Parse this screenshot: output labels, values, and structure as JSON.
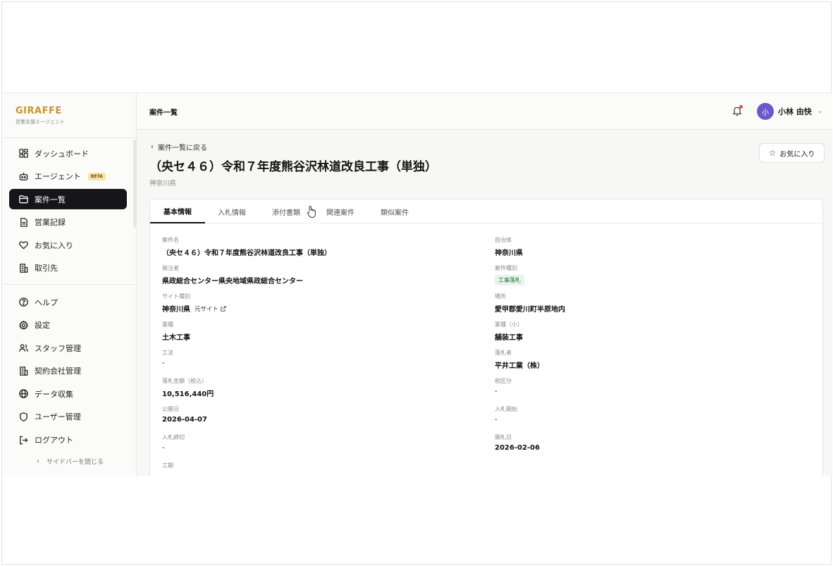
{
  "brand": {
    "name": "GIRAFFE",
    "subtitle": "営業支援エージェント"
  },
  "sidebar": {
    "main_items": [
      {
        "label": "ダッシュボード",
        "icon": "dashboard-icon"
      },
      {
        "label": "エージェント",
        "icon": "bot-icon",
        "badge": "BETA"
      },
      {
        "label": "案件一覧",
        "icon": "folder-icon",
        "active": true
      },
      {
        "label": "営業記録",
        "icon": "document-icon"
      },
      {
        "label": "お気に入り",
        "icon": "heart-icon"
      },
      {
        "label": "取引先",
        "icon": "building-icon"
      }
    ],
    "bottom_items": [
      {
        "label": "ヘルプ",
        "icon": "help-icon"
      },
      {
        "label": "設定",
        "icon": "gear-icon"
      },
      {
        "label": "スタッフ管理",
        "icon": "users-icon"
      },
      {
        "label": "契約会社管理",
        "icon": "building-icon"
      },
      {
        "label": "データ収集",
        "icon": "globe-icon"
      },
      {
        "label": "ユーザー管理",
        "icon": "shield-icon"
      },
      {
        "label": "ログアウト",
        "icon": "logout-icon"
      }
    ],
    "collapse_label": "サイドバーを閉じる"
  },
  "header": {
    "title": "案件一覧",
    "user": {
      "initial": "小",
      "name": "小林 由快"
    }
  },
  "detail": {
    "back_label": "案件一覧に戻る",
    "title": "（央セ４６）令和７年度熊谷沢林道改良工事（単独）",
    "subtitle": "神奈川県",
    "favorite_label": "お気に入り",
    "tabs": [
      "基本情報",
      "入札情報",
      "添付書類",
      "関連案件",
      "類似案件"
    ],
    "active_tab": "基本情報",
    "fields_left": [
      {
        "label": "案件名",
        "value": "（央セ４６）令和７年度熊谷沢林道改良工事（単独）"
      },
      {
        "label": "発注者",
        "value": "県政総合センター県央地域県政総合センター"
      },
      {
        "label": "サイト種別",
        "value": "神奈川県",
        "link": "元サイト"
      },
      {
        "label": "業種",
        "value": "土木工事"
      },
      {
        "label": "工法",
        "value": "-"
      },
      {
        "label": "落札金額（税込）",
        "value": "10,516,440円"
      },
      {
        "label": "公開日",
        "value": "2026-04-07"
      },
      {
        "label": "入札締切",
        "value": "-"
      },
      {
        "label": "工期",
        "value": ""
      }
    ],
    "fields_right": [
      {
        "label": "自治体",
        "value": "神奈川県"
      },
      {
        "label": "案件種別",
        "value": "工事落札",
        "tag": true
      },
      {
        "label": "場所",
        "value": "愛甲郡愛川町半原地内"
      },
      {
        "label": "業種（小）",
        "value": "舗装工事"
      },
      {
        "label": "落札者",
        "value": "平井工業（株）"
      },
      {
        "label": "税区分",
        "value": "-"
      },
      {
        "label": "入札開始",
        "value": "-"
      },
      {
        "label": "開札日",
        "value": "2026-02-06"
      }
    ]
  },
  "colors": {
    "brand": "#c9952a",
    "active_nav": "#16161a",
    "avatar": "#6e57c8",
    "tag_bg": "#e6f4ea",
    "notification_dot": "#d35a3a"
  }
}
